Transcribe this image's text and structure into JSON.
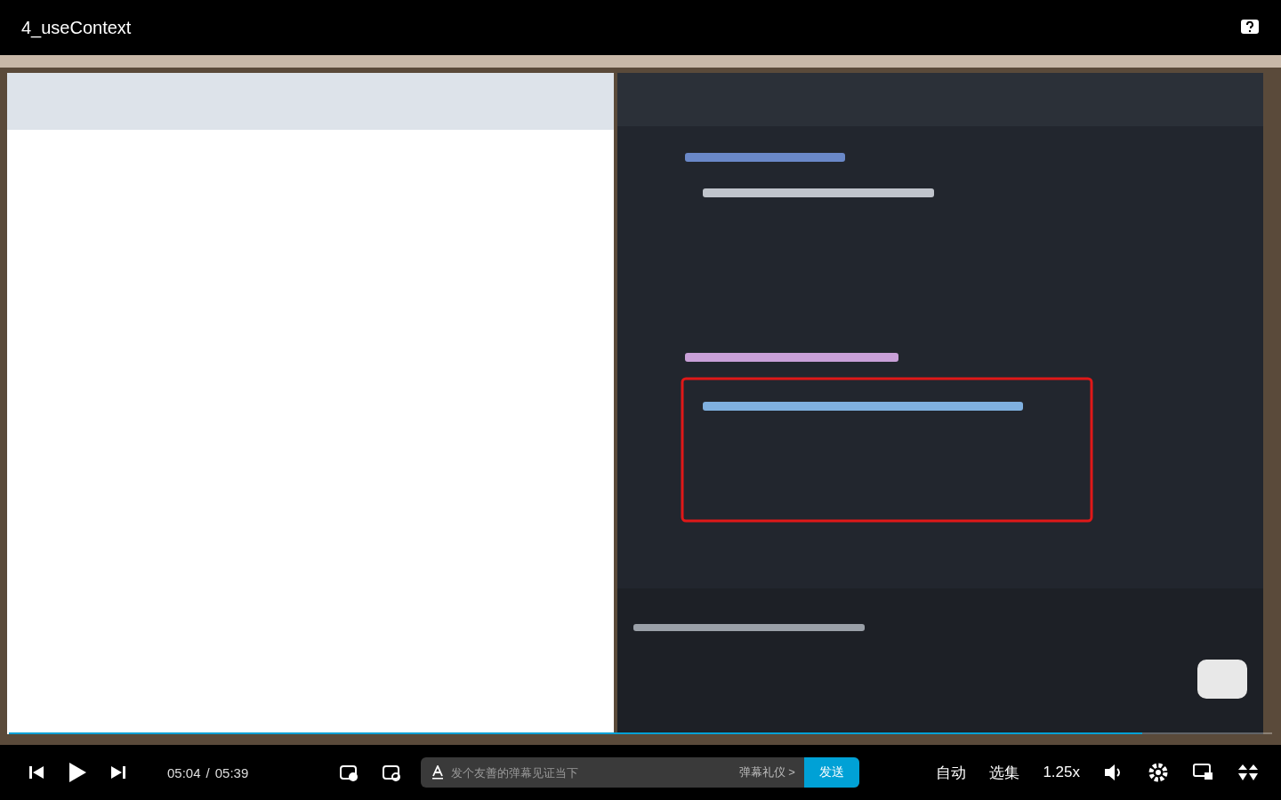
{
  "window": {
    "title": "4_useContext"
  },
  "progress": {
    "level": 0.897
  },
  "controls": {
    "current_time": "05:04",
    "separator": "/",
    "duration": "05:39",
    "danmaku_input": {
      "placeholder": "发个友善的弹幕见证当下"
    },
    "etiquette": "弹幕礼仪 >",
    "send": "发送",
    "options": [
      {
        "label": "自动"
      },
      {
        "label": "选集"
      },
      {
        "label": "1.25x"
      }
    ]
  }
}
